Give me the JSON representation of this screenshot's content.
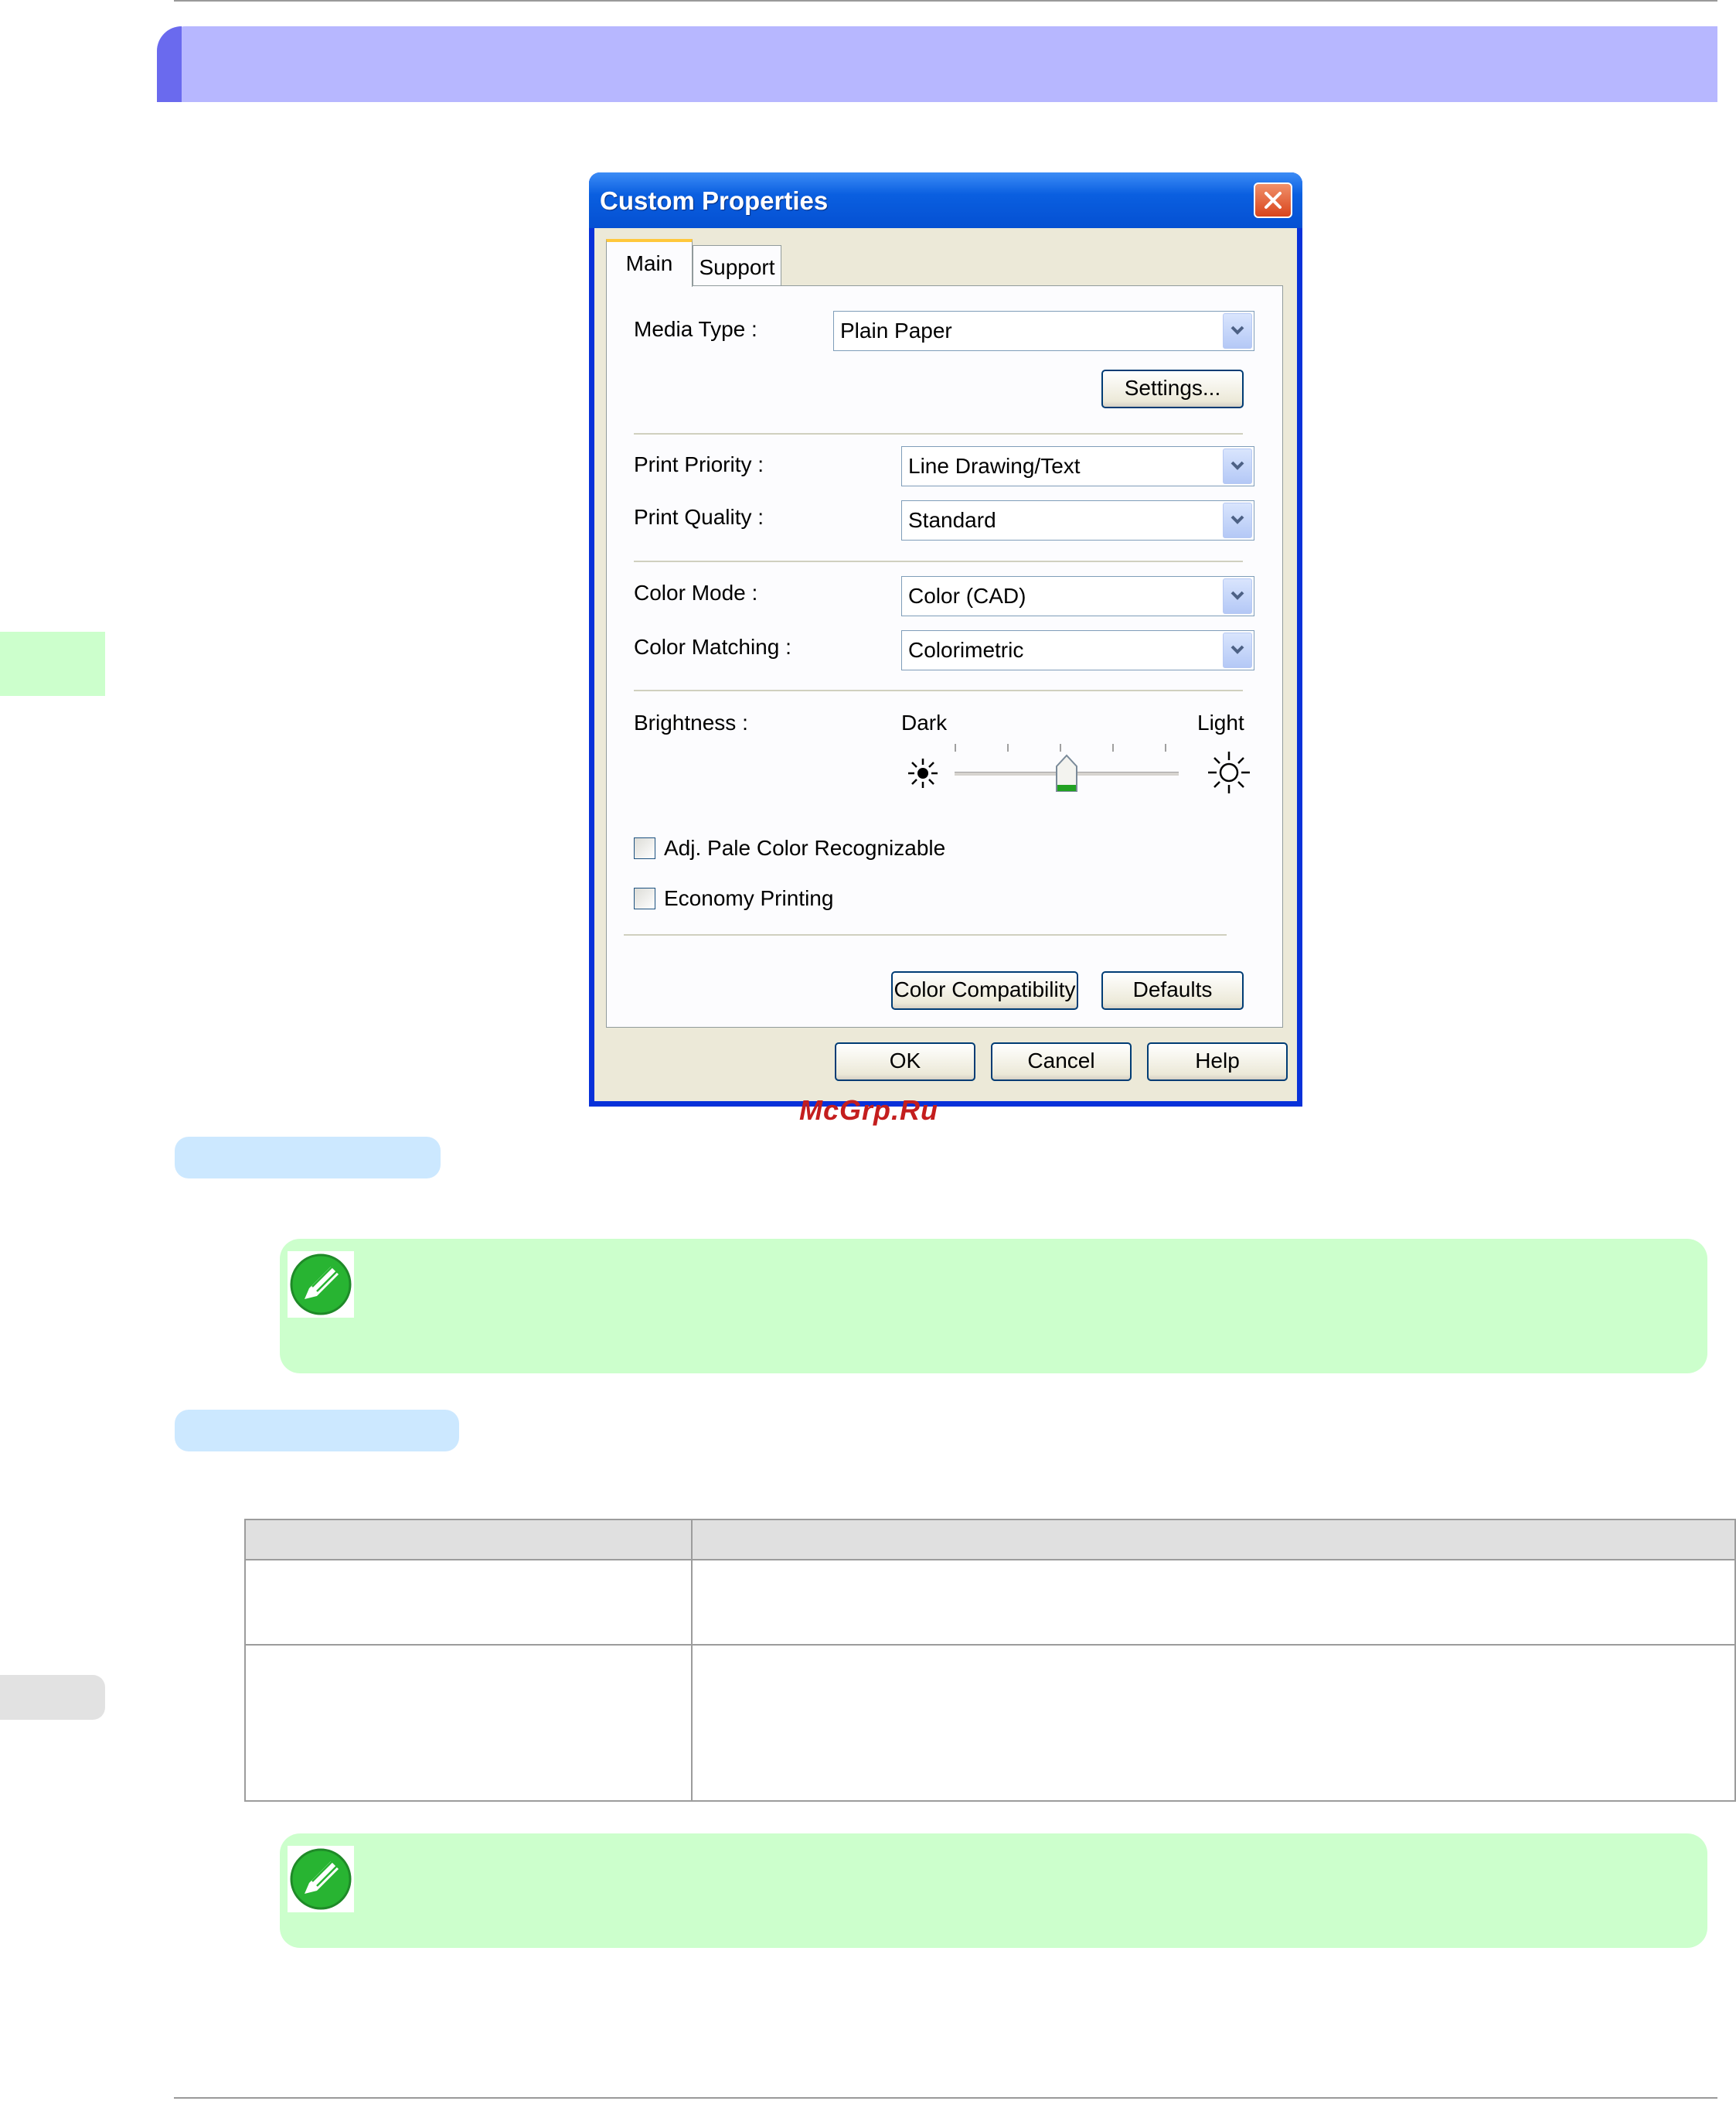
{
  "dialog": {
    "title": "Custom Properties",
    "tabs": [
      {
        "label": "Main",
        "selected": true
      },
      {
        "label": "Support",
        "selected": false
      }
    ],
    "media_type": {
      "label": "Media Type :",
      "value": "Plain Paper"
    },
    "settings_button": "Settings...",
    "print_priority": {
      "label": "Print Priority :",
      "value": "Line Drawing/Text"
    },
    "print_quality": {
      "label": "Print Quality :",
      "value": "Standard"
    },
    "color_mode": {
      "label": "Color Mode :",
      "value": "Color (CAD)"
    },
    "color_matching": {
      "label": "Color Matching :",
      "value": "Colorimetric"
    },
    "brightness": {
      "label": "Brightness :",
      "min_label": "Dark",
      "max_label": "Light",
      "level_fraction": 0.5
    },
    "adj_pale_color": {
      "label": "Adj. Pale Color Recognizable",
      "checked": false
    },
    "economy_printing": {
      "label": "Economy Printing",
      "checked": false
    },
    "color_compatibility_button": "Color Compatibility",
    "defaults_button": "Defaults",
    "ok_button": "OK",
    "cancel_button": "Cancel",
    "help_button": "Help"
  },
  "watermark": "McGrp.Ru",
  "colors": {
    "title_band": "#b7b7ff",
    "section_pill": "#cce8ff",
    "note_bg": "#ccffcc",
    "xp_titlebar": "#0a5fe0"
  },
  "icons": [
    "close-icon",
    "chevron-down-icon",
    "sun-dark-icon",
    "sun-light-icon",
    "note-pencil-icon"
  ]
}
